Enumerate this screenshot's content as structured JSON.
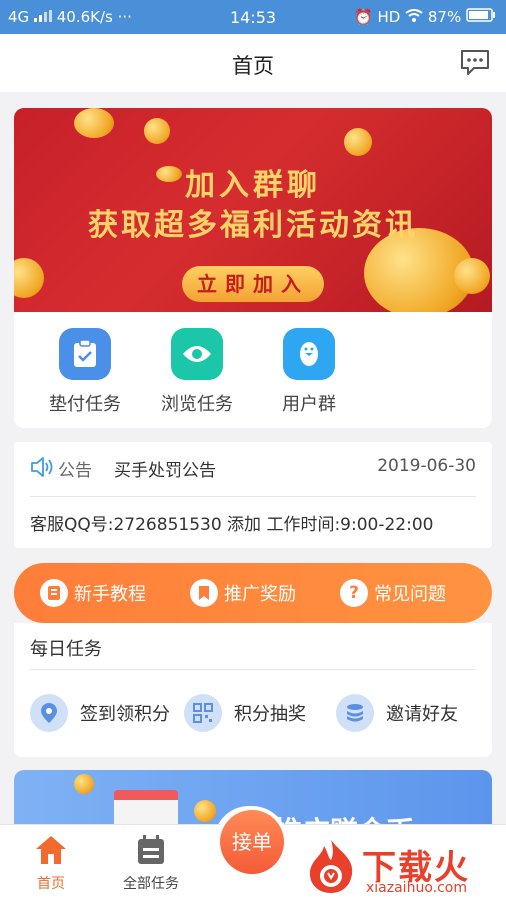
{
  "status_bar": {
    "network": "4G",
    "speed": "40.6K/s",
    "time": "14:53",
    "hd": "HD",
    "battery": "87%"
  },
  "header": {
    "title": "首页",
    "message_icon": "chat-bubble-icon"
  },
  "banner": {
    "line1": "加入群聊",
    "line2": "获取超多福利活动资讯",
    "button_label": "立即加入",
    "colors": {
      "background": "#c8202a",
      "text": "#ffd36a"
    }
  },
  "quick_actions": [
    {
      "label": "垫付任务",
      "icon": "clipboard-check-icon",
      "color": "#4a8fe8"
    },
    {
      "label": "浏览任务",
      "icon": "eye-icon",
      "color": "#1cc6a8"
    },
    {
      "label": "用户群",
      "icon": "penguin-icon",
      "color": "#2fa6f2"
    }
  ],
  "notice": {
    "label": "公告",
    "text": "买手处罚公告",
    "date": "2019-06-30",
    "service_line": "客服QQ号:2726851530 添加  工作时间:9:00-22:00"
  },
  "help_bar": {
    "items": [
      {
        "label": "新手教程",
        "icon": "book-icon"
      },
      {
        "label": "推广奖励",
        "icon": "bookmark-icon"
      },
      {
        "label": "常见问题",
        "icon": "question-icon"
      }
    ],
    "color": "#ff7e3a"
  },
  "daily_tasks": {
    "title": "每日任务",
    "items": [
      {
        "label": "签到领积分",
        "icon": "location-pin-icon"
      },
      {
        "label": "积分抽奖",
        "icon": "qr-code-icon"
      },
      {
        "label": "邀请好友",
        "icon": "coin-stack-icon"
      }
    ]
  },
  "promo": {
    "partial_text": "推广赚金币"
  },
  "tab_bar": {
    "tabs": [
      {
        "label": "首页",
        "icon": "home-icon",
        "active": true
      },
      {
        "label": "全部任务",
        "icon": "calendar-icon",
        "active": false
      }
    ],
    "fab_label": "接单",
    "active_color": "#f26a2e"
  },
  "watermark": {
    "text": "下载火",
    "sub": "xiazaihuo.com"
  }
}
